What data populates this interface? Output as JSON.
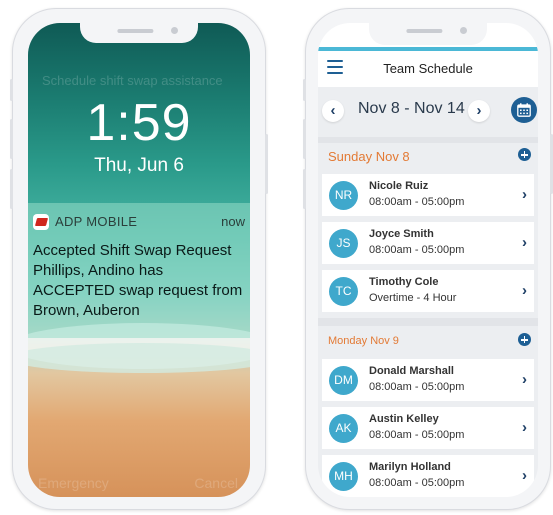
{
  "lock_screen": {
    "faded_top": "Schedule shift swap assistance",
    "time": "1:59",
    "date": "Thu, Jun 6",
    "notification": {
      "app": "ADP MOBILE",
      "when": "now",
      "message": "Accepted Shift Swap Request Phillips, Andino has ACCEPTED swap request from Brown, Auberon"
    },
    "bottom_left": "Emergency",
    "bottom_right": "Cancel"
  },
  "team_schedule": {
    "title": "Team Schedule",
    "week": "Nov 8 - Nov 14",
    "prev_glyph": "‹",
    "next_glyph": "›",
    "colors": {
      "accent": "#e37a35",
      "primary": "#1e5f94",
      "avatar": "#3fa8cc",
      "bar": "#4bb8d6"
    },
    "days": [
      {
        "label": "Sunday Nov 8",
        "employees": [
          {
            "initials": "NR",
            "name": "Nicole Ruiz",
            "shift": "08:00am - 05:00pm"
          },
          {
            "initials": "JS",
            "name": "Joyce Smith",
            "shift": "08:00am - 05:00pm"
          },
          {
            "initials": "TC",
            "name": "Timothy Cole",
            "shift": "Overtime - 4 Hour"
          }
        ]
      },
      {
        "label": "Monday Nov 9",
        "employees": [
          {
            "initials": "DM",
            "name": "Donald Marshall",
            "shift": "08:00am - 05:00pm"
          },
          {
            "initials": "AK",
            "name": "Austin Kelley",
            "shift": "08:00am - 05:00pm"
          },
          {
            "initials": "MH",
            "name": "Marilyn Holland",
            "shift": "08:00am - 05:00pm"
          }
        ]
      }
    ]
  }
}
